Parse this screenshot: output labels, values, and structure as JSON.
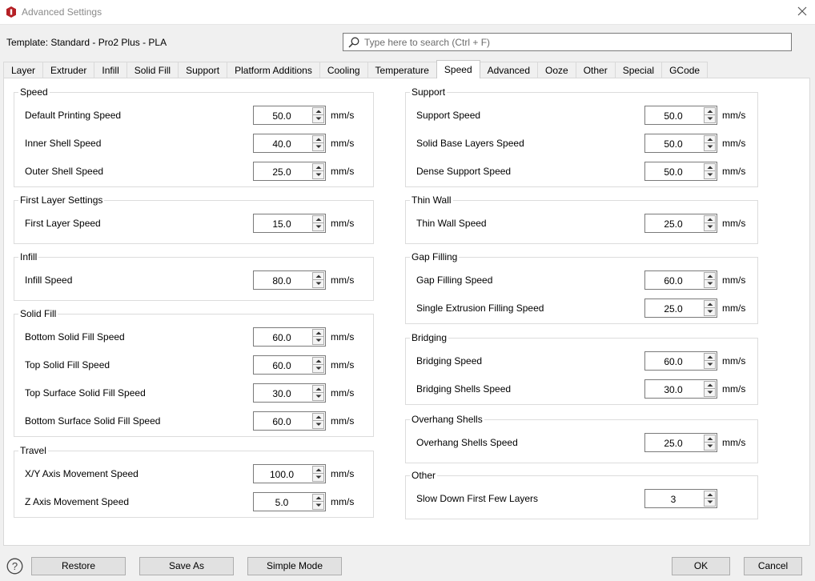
{
  "window": {
    "title": "Advanced Settings"
  },
  "template_label": "Template: Standard - Pro2 Plus - PLA",
  "search": {
    "placeholder": "Type here to search (Ctrl + F)",
    "value": ""
  },
  "tabs": [
    "Layer",
    "Extruder",
    "Infill",
    "Solid Fill",
    "Support",
    "Platform Additions",
    "Cooling",
    "Temperature",
    "Speed",
    "Advanced",
    "Ooze",
    "Other",
    "Special",
    "GCode"
  ],
  "active_tab": "Speed",
  "unit": "mm/s",
  "left_groups": [
    {
      "title": "Speed",
      "rows": [
        {
          "label": "Default Printing Speed",
          "value": "50.0"
        },
        {
          "label": "Inner Shell Speed",
          "value": "40.0"
        },
        {
          "label": "Outer Shell Speed",
          "value": "25.0"
        }
      ]
    },
    {
      "title": "First Layer Settings",
      "rows": [
        {
          "label": "First Layer Speed",
          "value": "15.0"
        }
      ]
    },
    {
      "title": "Infill",
      "rows": [
        {
          "label": "Infill Speed",
          "value": "80.0"
        }
      ]
    },
    {
      "title": "Solid Fill",
      "rows": [
        {
          "label": "Bottom Solid Fill Speed",
          "value": "60.0"
        },
        {
          "label": "Top Solid Fill Speed",
          "value": "60.0"
        },
        {
          "label": "Top Surface Solid Fill Speed",
          "value": "30.0"
        },
        {
          "label": "Bottom Surface Solid Fill Speed",
          "value": "60.0"
        }
      ]
    },
    {
      "title": "Travel",
      "rows": [
        {
          "label": "X/Y Axis Movement Speed",
          "value": "100.0"
        },
        {
          "label": "Z Axis Movement Speed",
          "value": "5.0"
        }
      ]
    }
  ],
  "right_groups": [
    {
      "title": "Support",
      "rows": [
        {
          "label": "Support Speed",
          "value": "50.0"
        },
        {
          "label": "Solid Base Layers Speed",
          "value": "50.0"
        },
        {
          "label": "Dense Support Speed",
          "value": "50.0"
        }
      ]
    },
    {
      "title": "Thin Wall",
      "rows": [
        {
          "label": "Thin Wall Speed",
          "value": "25.0"
        }
      ]
    },
    {
      "title": "Gap Filling",
      "rows": [
        {
          "label": "Gap Filling Speed",
          "value": "60.0"
        },
        {
          "label": "Single Extrusion Filling Speed",
          "value": "25.0"
        }
      ]
    },
    {
      "title": "Bridging",
      "rows": [
        {
          "label": "Bridging Speed",
          "value": "60.0"
        },
        {
          "label": "Bridging Shells Speed",
          "value": "30.0"
        }
      ]
    },
    {
      "title": "Overhang Shells",
      "rows": [
        {
          "label": "Overhang Shells Speed",
          "value": "25.0"
        }
      ]
    },
    {
      "title": "Other",
      "rows": [
        {
          "label": "Slow Down First Few Layers",
          "value": "3",
          "unit": ""
        }
      ]
    }
  ],
  "buttons": {
    "restore": "Restore",
    "save_as": "Save As",
    "simple_mode": "Simple Mode",
    "ok": "OK",
    "cancel": "Cancel"
  },
  "icons": {
    "app": "app-logo-icon",
    "close": "close-icon",
    "search": "search-icon",
    "help": "help-icon",
    "spin_up": "arrow-up-icon",
    "spin_down": "arrow-down-icon"
  },
  "colors": {
    "accent": "#b52025",
    "window": "#f0f0f0",
    "panel": "#ffffff"
  }
}
